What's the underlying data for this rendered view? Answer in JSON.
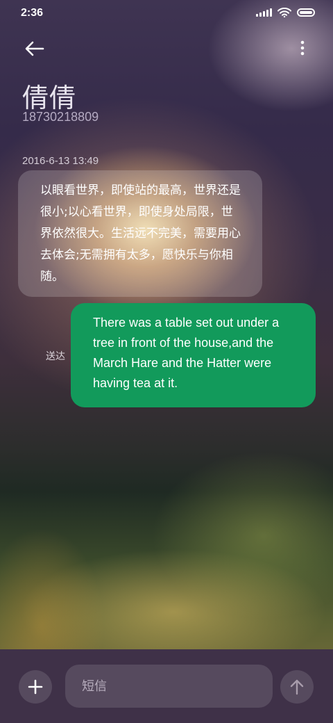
{
  "status_bar": {
    "time": "2:36",
    "icons": [
      "signal-icon",
      "wifi-icon",
      "battery-icon"
    ]
  },
  "header": {
    "back_icon": "arrow-left-icon",
    "menu_icon": "more-vertical-icon",
    "contact_name": "倩倩",
    "contact_number": "18730218809"
  },
  "conversation": {
    "timestamp": "2016-6-13 13:49",
    "messages": [
      {
        "direction": "incoming",
        "text": "以眼看世界，即使站的最高，世界还是很小;以心看世界，即使身处局限，世界依然很大。生活远不完美，需要用心去体会;无需拥有太多，愿快乐与你相随。"
      },
      {
        "direction": "outgoing",
        "text": "There was a table set out under a tree in front of the house,and the March Hare and the Hatter were having tea at it.",
        "status": "送达"
      }
    ]
  },
  "composer": {
    "add_icon": "plus-icon",
    "placeholder": "短信",
    "value": "",
    "send_icon": "arrow-up-icon"
  },
  "colors": {
    "outgoing_bubble": "#129a5b",
    "composer_background": "#3f3148"
  }
}
